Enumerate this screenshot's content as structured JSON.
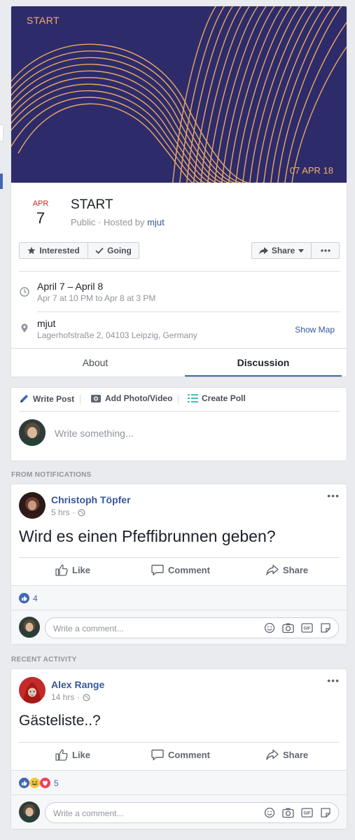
{
  "event": {
    "cover": {
      "title": "START",
      "date": "07 APR 18",
      "background_color": "#2e2b6b",
      "accent_color": "#f0b065"
    },
    "date_month": "APR",
    "date_day": "7",
    "title": "START",
    "visibility": "Public",
    "hosted_by_prefix": "· Hosted by",
    "host": "mjut",
    "buttons": {
      "interested": "Interested",
      "going": "Going",
      "share": "Share"
    },
    "time_main": "April 7 – April 8",
    "time_sub": "Apr 7 at 10 PM to Apr 8 at 3 PM",
    "location_name": "mjut",
    "location_address": "Lagerhofstraße 2, 04103 Leipzig, Germany",
    "show_map": "Show Map",
    "tabs": {
      "about": "About",
      "discussion": "Discussion"
    }
  },
  "composer": {
    "write_post": "Write Post",
    "add_photo": "Add Photo/Video",
    "create_poll": "Create Poll",
    "placeholder": "Write something..."
  },
  "sections": {
    "notifications": "FROM NOTIFICATIONS",
    "recent": "RECENT ACTIVITY"
  },
  "posts": [
    {
      "author": "Christoph Töpfer",
      "time": "5 hrs ·",
      "text": "Wird es einen Pfeffibrunnen geben?",
      "reactions": "4",
      "actions": {
        "like": "Like",
        "comment": "Comment",
        "share": "Share"
      },
      "comment_placeholder": "Write a comment..."
    },
    {
      "author": "Alex Range",
      "time": "14 hrs ·",
      "text": "Gästeliste..?",
      "reactions": "5",
      "actions": {
        "like": "Like",
        "comment": "Comment",
        "share": "Share"
      },
      "comment_placeholder": "Write a comment..."
    }
  ],
  "colors": {
    "link": "#365899",
    "brand": "#4267b2",
    "month_red": "#e02020"
  }
}
